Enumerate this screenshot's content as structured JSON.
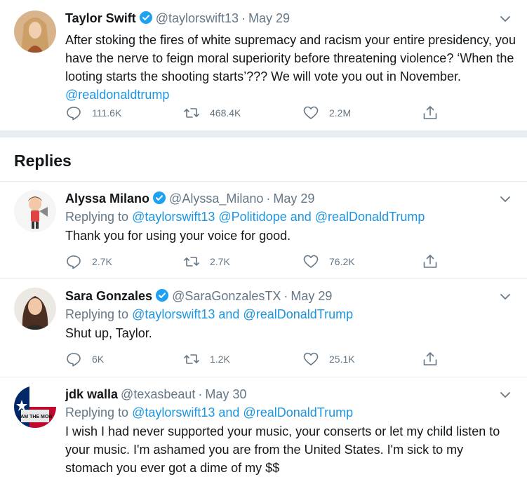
{
  "main_tweet": {
    "name": "Taylor Swift",
    "handle": "@taylorswift13",
    "date": "May 29",
    "text_before_link": "After stoking the fires of white supremacy and racism your entire presidency, you have the nerve to feign moral superiority before threatening violence? ‘When the looting starts the shooting starts’??? We will vote you out in November. ",
    "mention": "@realdonaldtrump",
    "replies": "111.6K",
    "retweets": "468.4K",
    "likes": "2.2M"
  },
  "replies_heading": "Replies",
  "replies": [
    {
      "name": "Alyssa Milano",
      "handle": "@Alyssa_Milano",
      "date": "May 29",
      "replying_label": "Replying to",
      "replying_to": "@taylorswift13 @Politidope and @realDonaldTrump",
      "text": "Thank you for using your voice for good.",
      "replies": "2.7K",
      "retweets": "2.7K",
      "likes": "76.2K"
    },
    {
      "name": "Sara Gonzales",
      "handle": "@SaraGonzalesTX",
      "date": "May 29",
      "replying_label": "Replying to",
      "replying_to": "@taylorswift13 and @realDonaldTrump",
      "text": "Shut up, Taylor.",
      "replies": "6K",
      "retweets": "1.2K",
      "likes": "25.1K"
    },
    {
      "name": "jdk walla",
      "handle": "@texasbeaut",
      "date": "May 30",
      "replying_label": "Replying to",
      "replying_to": "@taylorswift13 and @realDonaldTrump",
      "text": "I wish I had never supported your music, your conserts or let my child listen to your music. I'm ashamed you are from the United States.  I'm sick to my stomach you ever got a dime of my $$",
      "avatar_text": "I AM THE MOB"
    }
  ],
  "colors": {
    "link": "#1b95e0",
    "secondary_text": "#657786",
    "divider": "#e6ecf0",
    "verified": "#1da1f2"
  }
}
